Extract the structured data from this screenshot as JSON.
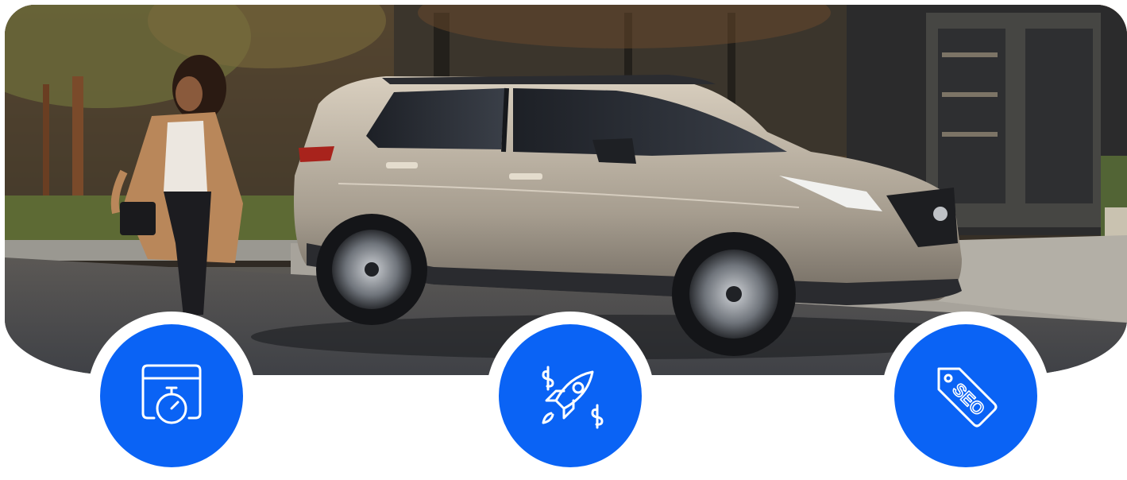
{
  "hero": {
    "image": "photo-hero"
  },
  "features": [
    {
      "icon": "stopwatch-calendar-icon"
    },
    {
      "icon": "rocket-money-icon"
    },
    {
      "icon": "seo-tag-icon"
    }
  ],
  "colors": {
    "accent": "#0a63f5",
    "icon_stroke": "#ffffff",
    "background": "#ffffff"
  }
}
